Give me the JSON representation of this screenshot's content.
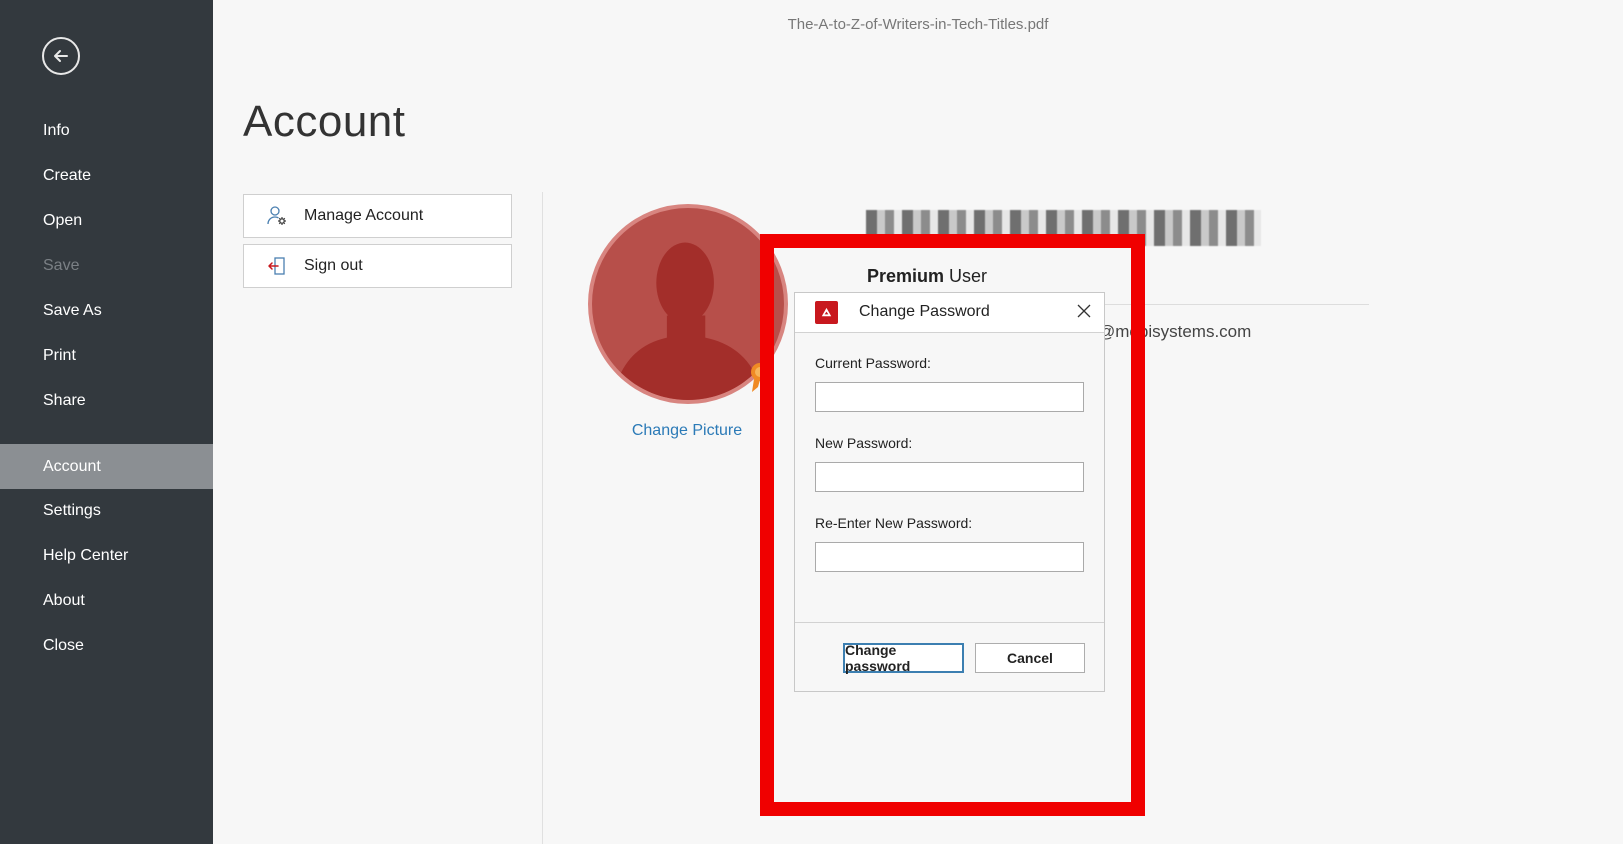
{
  "window": {
    "file_name": "The-A-to-Z-of-Writers-in-Tech-Titles.pdf"
  },
  "sidebar": {
    "back_icon": "arrow-left-circle-icon",
    "items": [
      {
        "label": "Info",
        "state": "normal"
      },
      {
        "label": "Create",
        "state": "normal"
      },
      {
        "label": "Open",
        "state": "normal"
      },
      {
        "label": "Save",
        "state": "disabled"
      },
      {
        "label": "Save As",
        "state": "normal"
      },
      {
        "label": "Print",
        "state": "normal"
      },
      {
        "label": "Share",
        "state": "normal"
      },
      {
        "label": "Account",
        "state": "active"
      },
      {
        "label": "Settings",
        "state": "normal"
      },
      {
        "label": "Help Center",
        "state": "normal"
      },
      {
        "label": "About",
        "state": "normal"
      },
      {
        "label": "Close",
        "state": "normal"
      }
    ]
  },
  "main": {
    "title": "Account",
    "actions": [
      {
        "label": "Manage Account",
        "icon": "user-gear-icon"
      },
      {
        "label": "Sign out",
        "icon": "sign-out-icon"
      }
    ],
    "profile": {
      "change_picture": "Change Picture",
      "plan_bold": "Premium",
      "plan_rest": " User",
      "email_fragment": "@mobisystems.com"
    }
  },
  "dialog": {
    "title": "Change Password",
    "icon": "app-logo-icon",
    "fields": [
      {
        "label": "Current Password:",
        "value": ""
      },
      {
        "label": "New Password:",
        "value": ""
      },
      {
        "label": "Re-Enter New Password:",
        "value": ""
      }
    ],
    "buttons": {
      "confirm": "Change password",
      "cancel": "Cancel"
    }
  },
  "colors": {
    "sidebar_bg": "#33393e",
    "sidebar_active": "#8b8f93",
    "link": "#2b7ab7",
    "highlight": "#f00000",
    "avatar": "#b74f4a",
    "brand_red": "#c8181e"
  }
}
